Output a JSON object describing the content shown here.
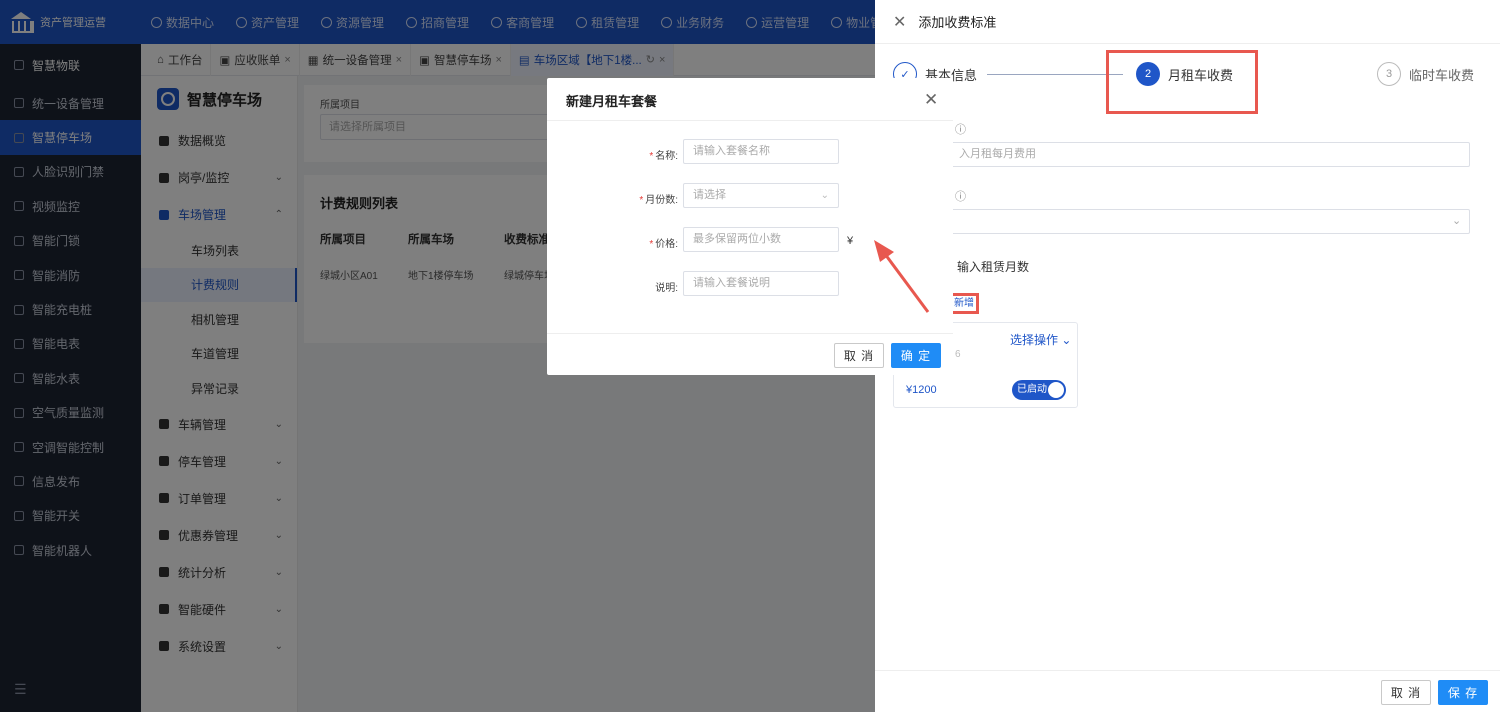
{
  "topbar": {
    "logo_text": "资产管理运营",
    "nav": [
      "数据中心",
      "资产管理",
      "资源管理",
      "招商管理",
      "客商管理",
      "租赁管理",
      "业务财务",
      "运营管理",
      "物业管理"
    ]
  },
  "sidebar": {
    "head": "智慧物联",
    "items": [
      "统一设备管理",
      "智慧停车场",
      "人脸识别门禁",
      "视频监控",
      "智能门锁",
      "智能消防",
      "智能充电桩",
      "智能电表",
      "智能水表",
      "空气质量监测",
      "空调智能控制",
      "信息发布",
      "智能开关",
      "智能机器人"
    ]
  },
  "tabs": [
    {
      "label": "工作台",
      "closable": false
    },
    {
      "label": "应收账单",
      "closable": true
    },
    {
      "label": "统一设备管理",
      "closable": true
    },
    {
      "label": "智慧停车场",
      "closable": true
    },
    {
      "label": "车场区域【地下1楼...",
      "closable": true
    }
  ],
  "subside": {
    "title": "智慧停车场",
    "items": [
      {
        "label": "数据概览",
        "type": "top",
        "chev": ""
      },
      {
        "label": "岗亭/监控",
        "type": "top",
        "chev": "⌄"
      },
      {
        "label": "车场管理",
        "type": "open",
        "chev": "⌃"
      },
      {
        "label": "车场列表",
        "type": "child",
        "chev": ""
      },
      {
        "label": "计费规则",
        "type": "selected",
        "chev": ""
      },
      {
        "label": "相机管理",
        "type": "child",
        "chev": ""
      },
      {
        "label": "车道管理",
        "type": "child",
        "chev": ""
      },
      {
        "label": "异常记录",
        "type": "child",
        "chev": ""
      },
      {
        "label": "车辆管理",
        "type": "top",
        "chev": "⌄"
      },
      {
        "label": "停车管理",
        "type": "top",
        "chev": "⌄"
      },
      {
        "label": "订单管理",
        "type": "top",
        "chev": "⌄"
      },
      {
        "label": "优惠券管理",
        "type": "top",
        "chev": "⌄"
      },
      {
        "label": "统计分析",
        "type": "top",
        "chev": "⌄"
      },
      {
        "label": "智能硬件",
        "type": "top",
        "chev": "⌄"
      },
      {
        "label": "系统设置",
        "type": "top",
        "chev": "⌄"
      }
    ]
  },
  "filter": {
    "label": "所属项目",
    "placeholder": "请选择所属项目"
  },
  "list": {
    "title": "计费规则列表",
    "headers": [
      "所属项目",
      "所属车场",
      "收费标准"
    ],
    "row": [
      "绿城小区A01",
      "地下1楼停车场",
      "绿城停车场"
    ]
  },
  "drawer": {
    "title": "添加收费标准",
    "steps": [
      {
        "num": "✓",
        "label": "基本信息"
      },
      {
        "num": "2",
        "label": "月租车收费"
      },
      {
        "num": "3",
        "label": "临时车收费"
      }
    ],
    "field1_placeholder": "入月租每月费用",
    "field2_placeholder": "",
    "month_text": "输入租赁月数",
    "add_text": "新增",
    "package": {
      "op": "选择操作",
      "num": "6",
      "price": "¥1200",
      "status": "已启动"
    },
    "cancel": "取 消",
    "save": "保 存"
  },
  "modal": {
    "title": "新建月租车套餐",
    "fields": [
      {
        "label": "名称:",
        "required": true,
        "placeholder": "请输入套餐名称"
      },
      {
        "label": "月份数:",
        "required": true,
        "placeholder": "请选择"
      },
      {
        "label": "价格:",
        "required": true,
        "placeholder": "最多保留两位小数"
      },
      {
        "label": "说明:",
        "required": false,
        "placeholder": "请输入套餐说明"
      }
    ],
    "currency": "¥",
    "cancel": "取 消",
    "confirm": "确 定"
  },
  "colors": {
    "primary": "#1f56c8",
    "button": "#1f8cf6",
    "highlight": "#e8584f"
  }
}
